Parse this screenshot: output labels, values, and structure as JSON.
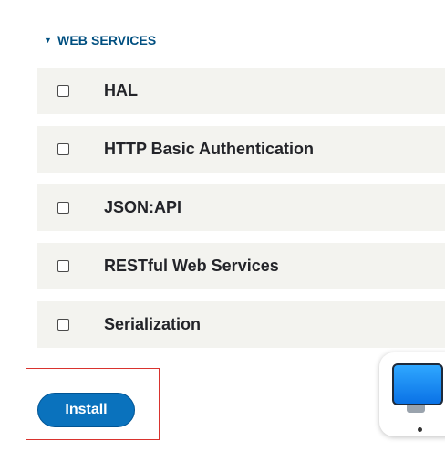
{
  "section": {
    "toggle_icon": "triangle-down-icon",
    "title": "WEB SERVICES"
  },
  "modules": [
    {
      "label": "HAL",
      "checked": false
    },
    {
      "label": "HTTP Basic Authentication",
      "checked": false
    },
    {
      "label": "JSON:API",
      "checked": false
    },
    {
      "label": "RESTful Web Services",
      "checked": false
    },
    {
      "label": "Serialization",
      "checked": false
    }
  ],
  "actions": {
    "install_label": "Install"
  },
  "dock": {
    "icon": "computer-monitor-icon"
  },
  "colors": {
    "header_text": "#004f80",
    "row_background": "#f3f3ef",
    "button_background": "#0a72bd",
    "highlight_border": "#d9332e"
  }
}
